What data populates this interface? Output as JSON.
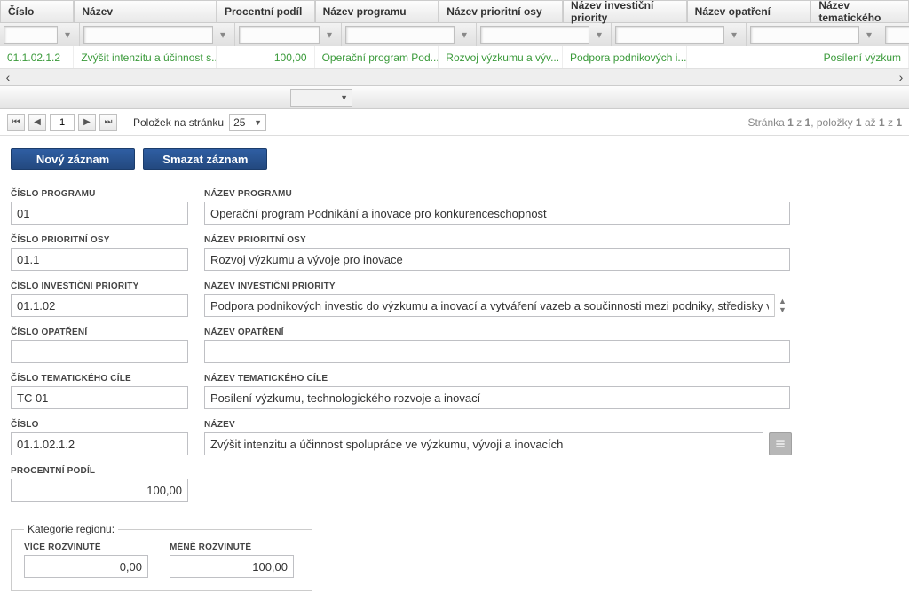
{
  "grid": {
    "headers": [
      "Číslo",
      "Název",
      "Procentní podíl",
      "Název programu",
      "Název prioritní osy",
      "Název investiční priority",
      "Název opatření",
      "Název tematického"
    ],
    "row": {
      "cislo": "01.1.02.1.2",
      "nazev": "Zvýšit intenzitu a účinnost s...",
      "procentni": "100,00",
      "program": "Operační program Pod...",
      "osa": "Rozvoj výzkumu a výv...",
      "investicni": "Podpora podnikových i...",
      "opatreni": "",
      "tematicke": "Posílení výzkum"
    }
  },
  "pager": {
    "page": "1",
    "perpage_label": "Položek na stránku",
    "perpage_value": "25",
    "info_prefix": "Stránka ",
    "info_page": "1",
    "info_mid": " z ",
    "info_total": "1",
    "info_items_mid": ", položky ",
    "info_from": "1",
    "info_to_word": " až ",
    "info_to": "1",
    "info_z": " z ",
    "info_count": "1"
  },
  "buttons": {
    "novy": "Nový záznam",
    "smazat": "Smazat záznam"
  },
  "form": {
    "cislo_programu_lbl": "ČÍSLO PROGRAMU",
    "cislo_programu": "01",
    "nazev_programu_lbl": "NÁZEV PROGRAMU",
    "nazev_programu": "Operační program Podnikání a inovace pro konkurenceschopnost",
    "cislo_osy_lbl": "ČÍSLO PRIORITNÍ OSY",
    "cislo_osy": "01.1",
    "nazev_osy_lbl": "NÁZEV PRIORITNÍ OSY",
    "nazev_osy": "Rozvoj výzkumu a vývoje pro inovace",
    "cislo_inv_lbl": "ČÍSLO INVESTIČNÍ PRIORITY",
    "cislo_inv": "01.1.02",
    "nazev_inv_lbl": "NÁZEV INVESTIČNÍ PRIORITY",
    "nazev_inv": "Podpora podnikových investic do výzkumu a inovací a vytváření vazeb a součinnosti mezi podniky, středisky výzkumu a",
    "cislo_opat_lbl": "ČÍSLO OPATŘENÍ",
    "cislo_opat": "",
    "nazev_opat_lbl": "NÁZEV OPATŘENÍ",
    "nazev_opat": "",
    "cislo_cile_lbl": "ČÍSLO TEMATICKÉHO CÍLE",
    "cislo_cile": "TC 01",
    "nazev_cile_lbl": "NÁZEV TEMATICKÉHO CÍLE",
    "nazev_cile": "Posílení výzkumu, technologického rozvoje a inovací",
    "cislo_lbl": "ČÍSLO",
    "cislo": "01.1.02.1.2",
    "nazev_lbl": "NÁZEV",
    "nazev": "Zvýšit intenzitu a účinnost spolupráce ve výzkumu, vývoji a inovacích",
    "procentni_lbl": "PROCENTNÍ PODÍL",
    "procentni": "100,00",
    "kat_legend": "Kategorie regionu:",
    "vice_lbl": "VÍCE ROZVINUTÉ",
    "vice": "0,00",
    "mene_lbl": "MÉNĚ ROZVINUTÉ",
    "mene": "100,00"
  }
}
